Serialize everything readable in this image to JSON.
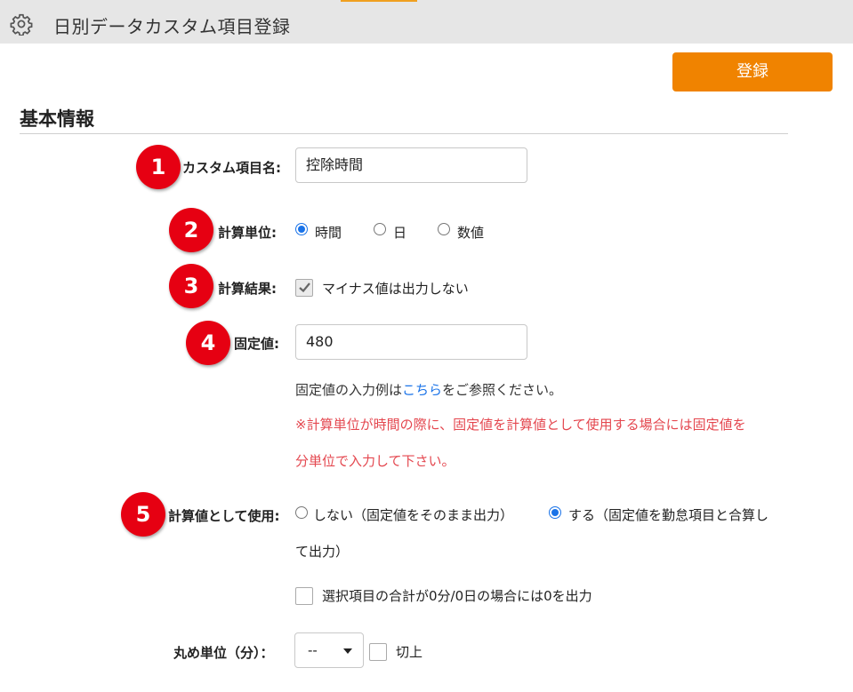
{
  "header": {
    "title": "日別データカスタム項目登録",
    "icon": "gear-icon"
  },
  "toolbar": {
    "register_label": "登録"
  },
  "section": {
    "title": "基本情報"
  },
  "form": {
    "custom_name": {
      "badge": "1",
      "label": "カスタム項目名:",
      "value": "控除時間"
    },
    "unit": {
      "badge": "2",
      "label": "計算単位:",
      "options": [
        {
          "label": "時間",
          "selected": true
        },
        {
          "label": "日",
          "selected": false
        },
        {
          "label": "数値",
          "selected": false
        }
      ]
    },
    "result": {
      "badge": "3",
      "label": "計算結果:",
      "checkbox_label": "マイナス値は出力しない",
      "checked": true
    },
    "fixed_value": {
      "badge": "4",
      "label": "固定値:",
      "value": "480",
      "note_before": "固定値の入力例は",
      "note_link": "こちら",
      "note_after": "をご参照ください。",
      "warning_line1": "※計算単位が時間の際に、固定値を計算値として使用する場合には固定値を",
      "warning_line2": "分単位で入力して下さい。"
    },
    "use_as_calc": {
      "badge": "5",
      "label": "計算値として使用:",
      "option_no": "しない（固定値をそのまま出力）",
      "option_yes_line1": "する（固定値を勤怠項目と合算し",
      "option_yes_line2": "て出力）",
      "selected": "yes",
      "sum_checkbox_label": "選択項目の合計が0分/0日の場合には0を出力",
      "sum_checked": false
    },
    "rounding": {
      "label": "丸め単位（分）：",
      "select_value": "--",
      "checkbox_label": "切上",
      "checked": false
    }
  },
  "colors": {
    "accent": "#f08300",
    "badge": "#e60012",
    "link": "#1a73e8",
    "warning": "#e4474f"
  }
}
